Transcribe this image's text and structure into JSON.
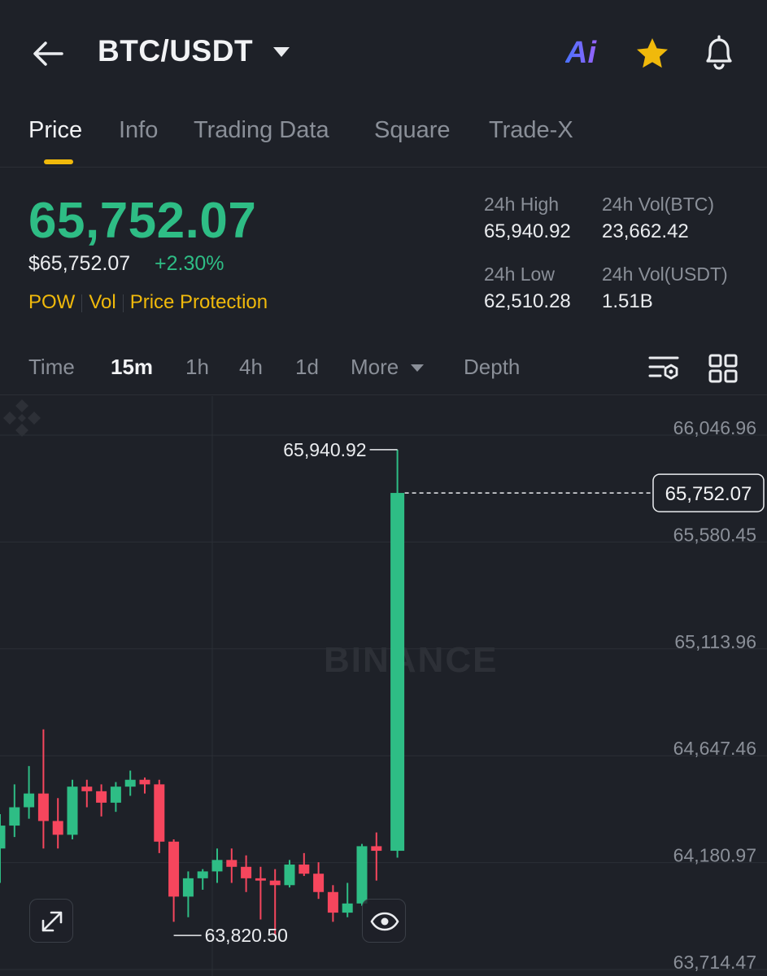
{
  "header": {
    "pair": "BTC/USDT",
    "icons": [
      "back-arrow-icon",
      "chevron-down-icon",
      "ai-icon",
      "star-icon",
      "bell-icon"
    ],
    "ai_label": "Ai",
    "star_color": "#f0b90b"
  },
  "tabs": [
    {
      "label": "Price",
      "active": true
    },
    {
      "label": "Info",
      "active": false
    },
    {
      "label": "Trading Data",
      "active": false
    },
    {
      "label": "Square",
      "active": false
    },
    {
      "label": "Trade-X",
      "active": false
    }
  ],
  "price": {
    "last": "65,752.07",
    "usd": "$65,752.07",
    "change_pct": "+2.30%",
    "tags": [
      "POW",
      "Vol",
      "Price Protection"
    ]
  },
  "stats": {
    "high_label": "24h High",
    "high_value": "65,940.92",
    "vol_btc_label": "24h Vol(BTC)",
    "vol_btc_value": "23,662.42",
    "low_label": "24h Low",
    "low_value": "62,510.28",
    "vol_usdt_label": "24h Vol(USDT)",
    "vol_usdt_value": "1.51B"
  },
  "intervals": [
    {
      "label": "Time",
      "active": false
    },
    {
      "label": "15m",
      "active": true
    },
    {
      "label": "1h",
      "active": false
    },
    {
      "label": "4h",
      "active": false
    },
    {
      "label": "1d",
      "active": false
    },
    {
      "label": "More",
      "active": false
    },
    {
      "label": "Depth",
      "active": false
    }
  ],
  "colors": {
    "up": "#2ebd85",
    "down": "#f6465d",
    "accent": "#f0b90b",
    "background": "#1e2128"
  },
  "chart_data": {
    "type": "candlestick",
    "y_ticks": [
      "66,046.96",
      "65,580.45",
      "65,113.96",
      "64,647.46",
      "64,180.97",
      "63,714.47"
    ],
    "ylim": [
      63714.47,
      66046.96
    ],
    "current_price_label": "65,752.07",
    "current_price": 65752.07,
    "high_marker": {
      "label": "65,940.92",
      "value": 65940.92
    },
    "low_marker": {
      "label": "63,820.50",
      "value": 63820.5
    },
    "grid": true,
    "candles": [
      {
        "o": 64200,
        "h": 64350,
        "l": 64050,
        "c": 64300
      },
      {
        "o": 64300,
        "h": 64480,
        "l": 64250,
        "c": 64380
      },
      {
        "o": 64380,
        "h": 64560,
        "l": 64330,
        "c": 64440
      },
      {
        "o": 64440,
        "h": 64720,
        "l": 64200,
        "c": 64320
      },
      {
        "o": 64320,
        "h": 64420,
        "l": 64200,
        "c": 64260
      },
      {
        "o": 64260,
        "h": 64500,
        "l": 64240,
        "c": 64470
      },
      {
        "o": 64470,
        "h": 64500,
        "l": 64380,
        "c": 64450
      },
      {
        "o": 64450,
        "h": 64480,
        "l": 64340,
        "c": 64400
      },
      {
        "o": 64400,
        "h": 64490,
        "l": 64360,
        "c": 64470
      },
      {
        "o": 64470,
        "h": 64540,
        "l": 64430,
        "c": 64500
      },
      {
        "o": 64500,
        "h": 64510,
        "l": 64440,
        "c": 64480
      },
      {
        "o": 64480,
        "h": 64500,
        "l": 64180,
        "c": 64230
      },
      {
        "o": 64230,
        "h": 64240,
        "l": 63880,
        "c": 63990
      },
      {
        "o": 63990,
        "h": 64100,
        "l": 63900,
        "c": 64070
      },
      {
        "o": 64070,
        "h": 64110,
        "l": 64020,
        "c": 64100
      },
      {
        "o": 64100,
        "h": 64200,
        "l": 64050,
        "c": 64150
      },
      {
        "o": 64150,
        "h": 64200,
        "l": 64050,
        "c": 64120
      },
      {
        "o": 64120,
        "h": 64170,
        "l": 64010,
        "c": 64070
      },
      {
        "o": 64070,
        "h": 64120,
        "l": 63890,
        "c": 64060
      },
      {
        "o": 64060,
        "h": 64110,
        "l": 63820,
        "c": 64040
      },
      {
        "o": 64040,
        "h": 64150,
        "l": 64030,
        "c": 64130
      },
      {
        "o": 64130,
        "h": 64180,
        "l": 64080,
        "c": 64090
      },
      {
        "o": 64090,
        "h": 64140,
        "l": 63980,
        "c": 64010
      },
      {
        "o": 64010,
        "h": 64040,
        "l": 63880,
        "c": 63920
      },
      {
        "o": 63920,
        "h": 64050,
        "l": 63900,
        "c": 63960
      },
      {
        "o": 63960,
        "h": 64220,
        "l": 63950,
        "c": 64210
      },
      {
        "o": 64210,
        "h": 64270,
        "l": 64060,
        "c": 64190
      },
      {
        "o": 64190,
        "h": 65940.92,
        "l": 64160,
        "c": 65752.07
      }
    ]
  }
}
